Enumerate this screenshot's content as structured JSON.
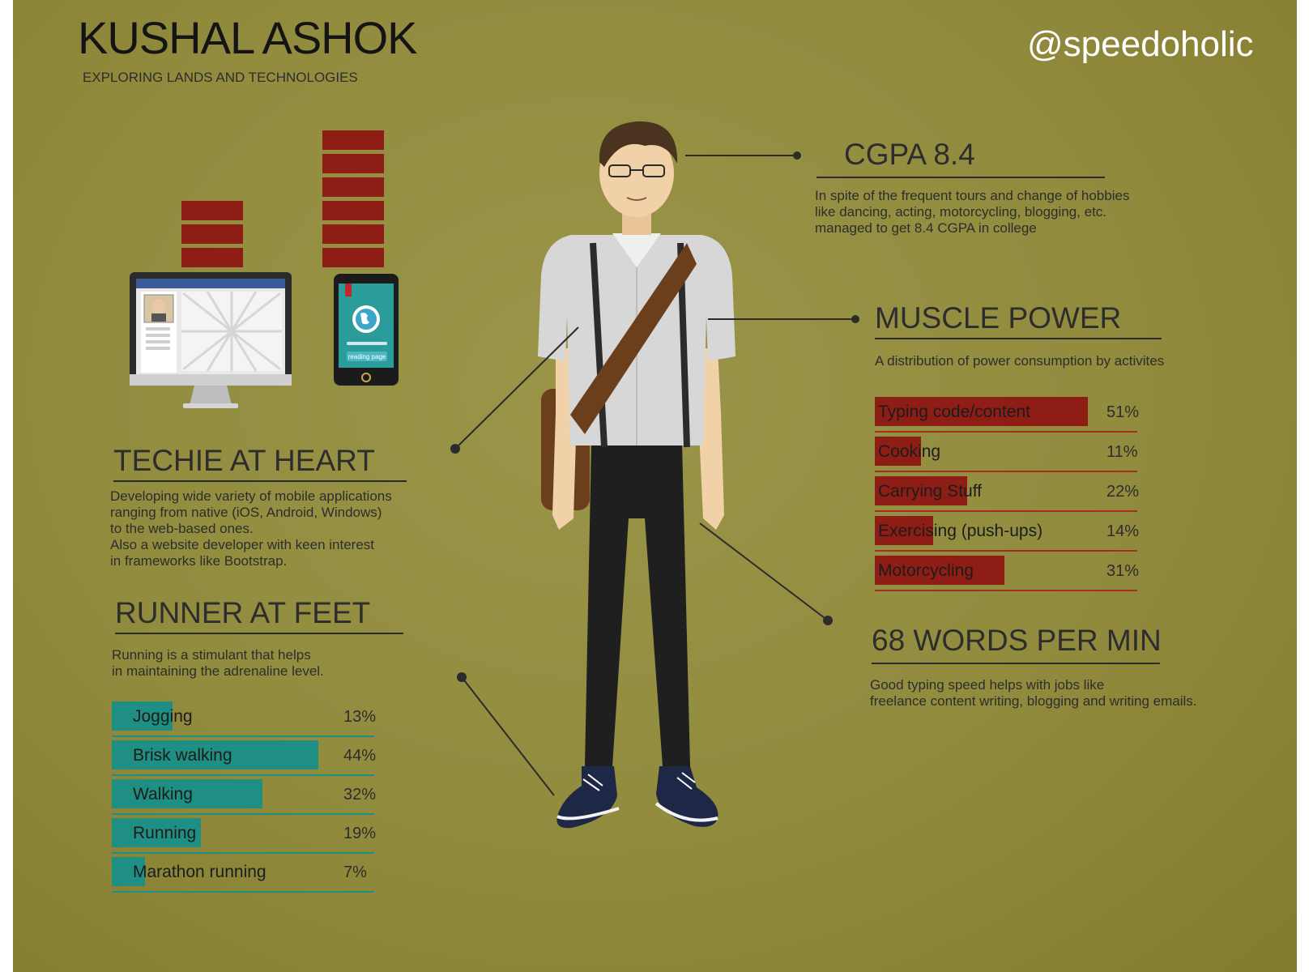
{
  "header": {
    "name": "KUSHAL ASHOK",
    "tagline": "EXPLORING LANDS AND TECHNOLOGIES",
    "handle": "@speedoholic"
  },
  "device_illustration": {
    "phone_button_label": "reading page"
  },
  "techie": {
    "title": "TECHIE AT HEART",
    "lines": [
      "Developing wide variety of mobile applications",
      "ranging from native (iOS, Android, Windows)",
      "to the web-based ones.",
      "Also a website developer with keen interest",
      "in frameworks like Bootstrap."
    ]
  },
  "runner": {
    "title": "RUNNER AT FEET",
    "lines": [
      "Running is a stimulant that helps",
      "in maintaining the adrenaline level."
    ]
  },
  "cgpa": {
    "title": "CGPA 8.4",
    "lines": [
      "In spite of the frequent tours and change of hobbies",
      "like dancing, acting, motorcycling, blogging, etc.",
      "managed to get 8.4 CGPA in college"
    ]
  },
  "muscle": {
    "title": "MUSCLE POWER",
    "subtitle": "A distribution of power consumption by activites"
  },
  "typing": {
    "title": "68 WORDS PER MIN",
    "lines": [
      "Good typing speed helps with jobs like",
      "freelance content writing, blogging and writing emails."
    ]
  },
  "chart_data": [
    {
      "type": "bar",
      "orientation": "horizontal",
      "title": "RUNNER AT FEET",
      "categories": [
        "Jogging",
        "Brisk walking",
        "Walking",
        "Running",
        "Marathon running"
      ],
      "values": [
        13,
        44,
        32,
        19,
        7
      ],
      "labels": [
        "13%",
        "44%",
        "32%",
        "19%",
        "7%"
      ],
      "color": "#1e8f82"
    },
    {
      "type": "bar",
      "orientation": "horizontal",
      "title": "MUSCLE POWER",
      "categories": [
        "Typing code/content",
        "Cooking",
        "Carrying Stuff",
        "Exercising (push-ups)",
        "Motorcycling"
      ],
      "values": [
        51,
        11,
        22,
        14,
        31
      ],
      "labels": [
        "51%",
        "11%",
        "22%",
        "14%",
        "31%"
      ],
      "color": "#8e1d16"
    }
  ],
  "device_stack_levels": {
    "monitor": 3,
    "phone": 6
  }
}
